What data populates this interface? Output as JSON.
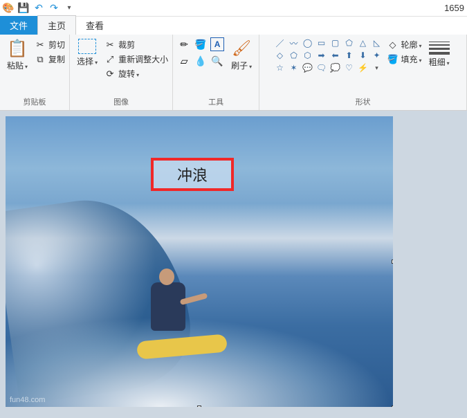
{
  "title_right": "1659",
  "tabs": {
    "file": "文件",
    "home": "主页",
    "view": "查看"
  },
  "clipboard": {
    "paste": "粘贴",
    "cut": "剪切",
    "copy": "复制",
    "group": "剪贴板"
  },
  "image": {
    "select": "选择",
    "crop": "裁剪",
    "resize": "重新调整大小",
    "rotate": "旋转",
    "group": "图像"
  },
  "tools": {
    "brush": "刷子",
    "group": "工具"
  },
  "shapes": {
    "outline": "轮廓",
    "fill": "填充",
    "stroke": "粗细",
    "group": "形状"
  },
  "canvas": {
    "text": "冲浪",
    "watermark": "fun48.com"
  }
}
